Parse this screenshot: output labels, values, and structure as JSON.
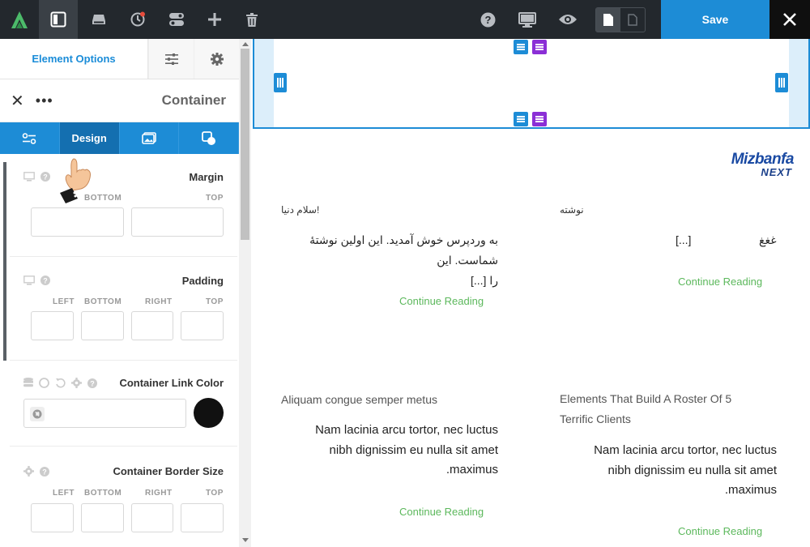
{
  "toolbar": {
    "save_label": "Save",
    "icons": [
      "builder-logo",
      "sidebar-toggle-icon",
      "drive-icon",
      "history-icon",
      "layout-toggle-icon",
      "plus-icon",
      "trash-icon",
      "help-icon",
      "desktop-icon",
      "eye-icon",
      "page-icon",
      "page-outline-icon",
      "close-icon"
    ]
  },
  "sidebar": {
    "tab_label": "Element Options",
    "title": "Container",
    "subtabs": {
      "design_label": "Design"
    },
    "margin": {
      "title": "Margin",
      "labels": [
        "BOTTOM",
        "TOP"
      ]
    },
    "padding": {
      "title": "Padding",
      "labels": [
        "LEFT",
        "BOTTOM",
        "RIGHT",
        "TOP"
      ]
    },
    "link_color": {
      "title": "Container Link Color",
      "swatch": "#111111"
    },
    "border_size": {
      "title": "Container Border Size",
      "labels": [
        "LEFT",
        "BOTTOM",
        "RIGHT",
        "TOP"
      ]
    }
  },
  "canvas": {
    "brand": {
      "line1": "Mizbanfa",
      "line2": "NEXT"
    },
    "posts": [
      {
        "title": "سلام دنیا!",
        "excerpt_line1": "به وردپرس خوش آمدید. این اولین نوشتهٔ شماست. این",
        "excerpt_line2": "را [...]",
        "more": "Continue Reading"
      },
      {
        "title": "نوشته",
        "excerpt_a": "[...]",
        "excerpt_b": "غغغ",
        "more": "Continue Reading"
      },
      {
        "title": "Aliquam congue semper metus",
        "excerpt_line1": "Nam lacinia arcu tortor, nec luctus",
        "excerpt_line2": "nibh dignissim eu nulla sit amet",
        "excerpt_line3": "maximus.",
        "more": "Continue Reading"
      },
      {
        "title_line1": "Elements That Build A Roster Of 5",
        "title_line2": "Terrific Clients",
        "excerpt_line1": "Nam lacinia arcu tortor, nec luctus",
        "excerpt_line2": "nibh dignissim eu nulla sit amet",
        "excerpt_line3": "maximus.",
        "more": "Continue Reading"
      }
    ]
  },
  "colors": {
    "accent": "#1d8cd6",
    "topbar": "#23282d",
    "handle_purple": "#8b2fd6",
    "link_green": "#5cb85c"
  }
}
